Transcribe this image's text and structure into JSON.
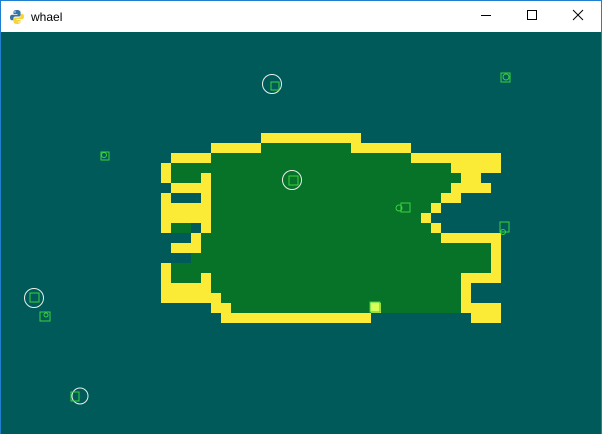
{
  "window": {
    "title": "whael",
    "controls": {
      "minimize": "minimize",
      "maximize": "maximize",
      "close": "close"
    }
  },
  "colors": {
    "water": "#005a5a",
    "land": "#077329",
    "shore": "#fbeb36",
    "entity": "#3bd23b",
    "ring": "#e8f0e8",
    "titlebar": "#ffffff",
    "border": "#1f7fd0"
  },
  "icons": {
    "app": "python-icon",
    "minimize": "minimize-icon",
    "maximize": "maximize-icon",
    "close": "close-icon"
  }
}
